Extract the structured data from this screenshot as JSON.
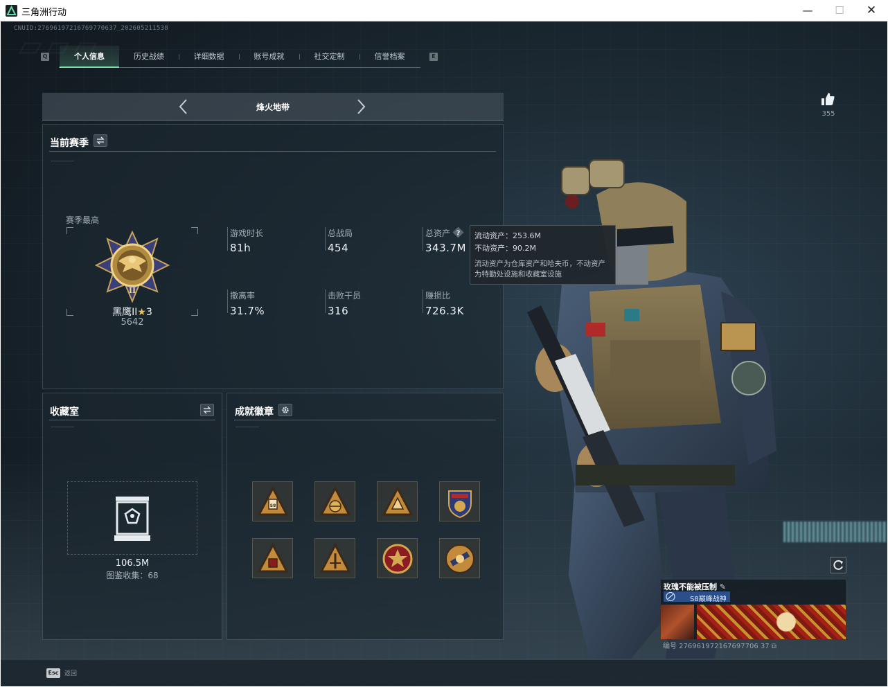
{
  "window": {
    "title": "三角洲行动",
    "minimize": "—",
    "maximize": "☐",
    "close": "✕"
  },
  "cnuid": "CNUID:27696197216769770637_202605211538",
  "tabs": {
    "left_key": "Q",
    "right_key": "E",
    "items": [
      {
        "label": "个人信息",
        "active": true
      },
      {
        "label": "历史战绩",
        "active": false
      },
      {
        "label": "详细数据",
        "active": false
      },
      {
        "label": "账号成就",
        "active": false
      },
      {
        "label": "社交定制",
        "active": false
      },
      {
        "label": "信誉档案",
        "active": false
      }
    ]
  },
  "mode": {
    "title": "烽火地带"
  },
  "season": {
    "title": "当前赛季",
    "best_label": "赛季最高",
    "rank_name": "黑鹰II",
    "rank_stars": "3",
    "rank_score": "5642",
    "stats": [
      {
        "label": "游戏时长",
        "value": "81h"
      },
      {
        "label": "总战局",
        "value": "454"
      },
      {
        "label": "总资产",
        "value": "343.7M"
      },
      {
        "label": "撤离率",
        "value": "31.7%"
      },
      {
        "label": "击败干员",
        "value": "316"
      },
      {
        "label": "赚损比",
        "value": "726.3K"
      }
    ]
  },
  "tooltip": {
    "liquid": "流动资产：253.6M",
    "fixed": "不动资产：90.2M",
    "note": "流动资产为仓库资产和哈夫币，不动资产为特勤处设施和收藏室设施"
  },
  "collection": {
    "title": "收藏室",
    "value": "106.5M",
    "count": "图鉴收集：68"
  },
  "achievements": {
    "title": "成就徽章",
    "badges": [
      "badge-1",
      "badge-2",
      "badge-3",
      "badge-4",
      "badge-5",
      "badge-6",
      "badge-7",
      "badge-8"
    ]
  },
  "likes": {
    "count": "355"
  },
  "card": {
    "name": "玫瑰不能被压制",
    "tag": "S8巅峰战神",
    "id": "编号 276961972167697706 37"
  },
  "footer": {
    "esc_key": "Esc",
    "esc_label": "返回"
  },
  "colors": {
    "accent": "#7be0a8",
    "panel_bg": "#1c262f",
    "background": "#1e2c36"
  }
}
